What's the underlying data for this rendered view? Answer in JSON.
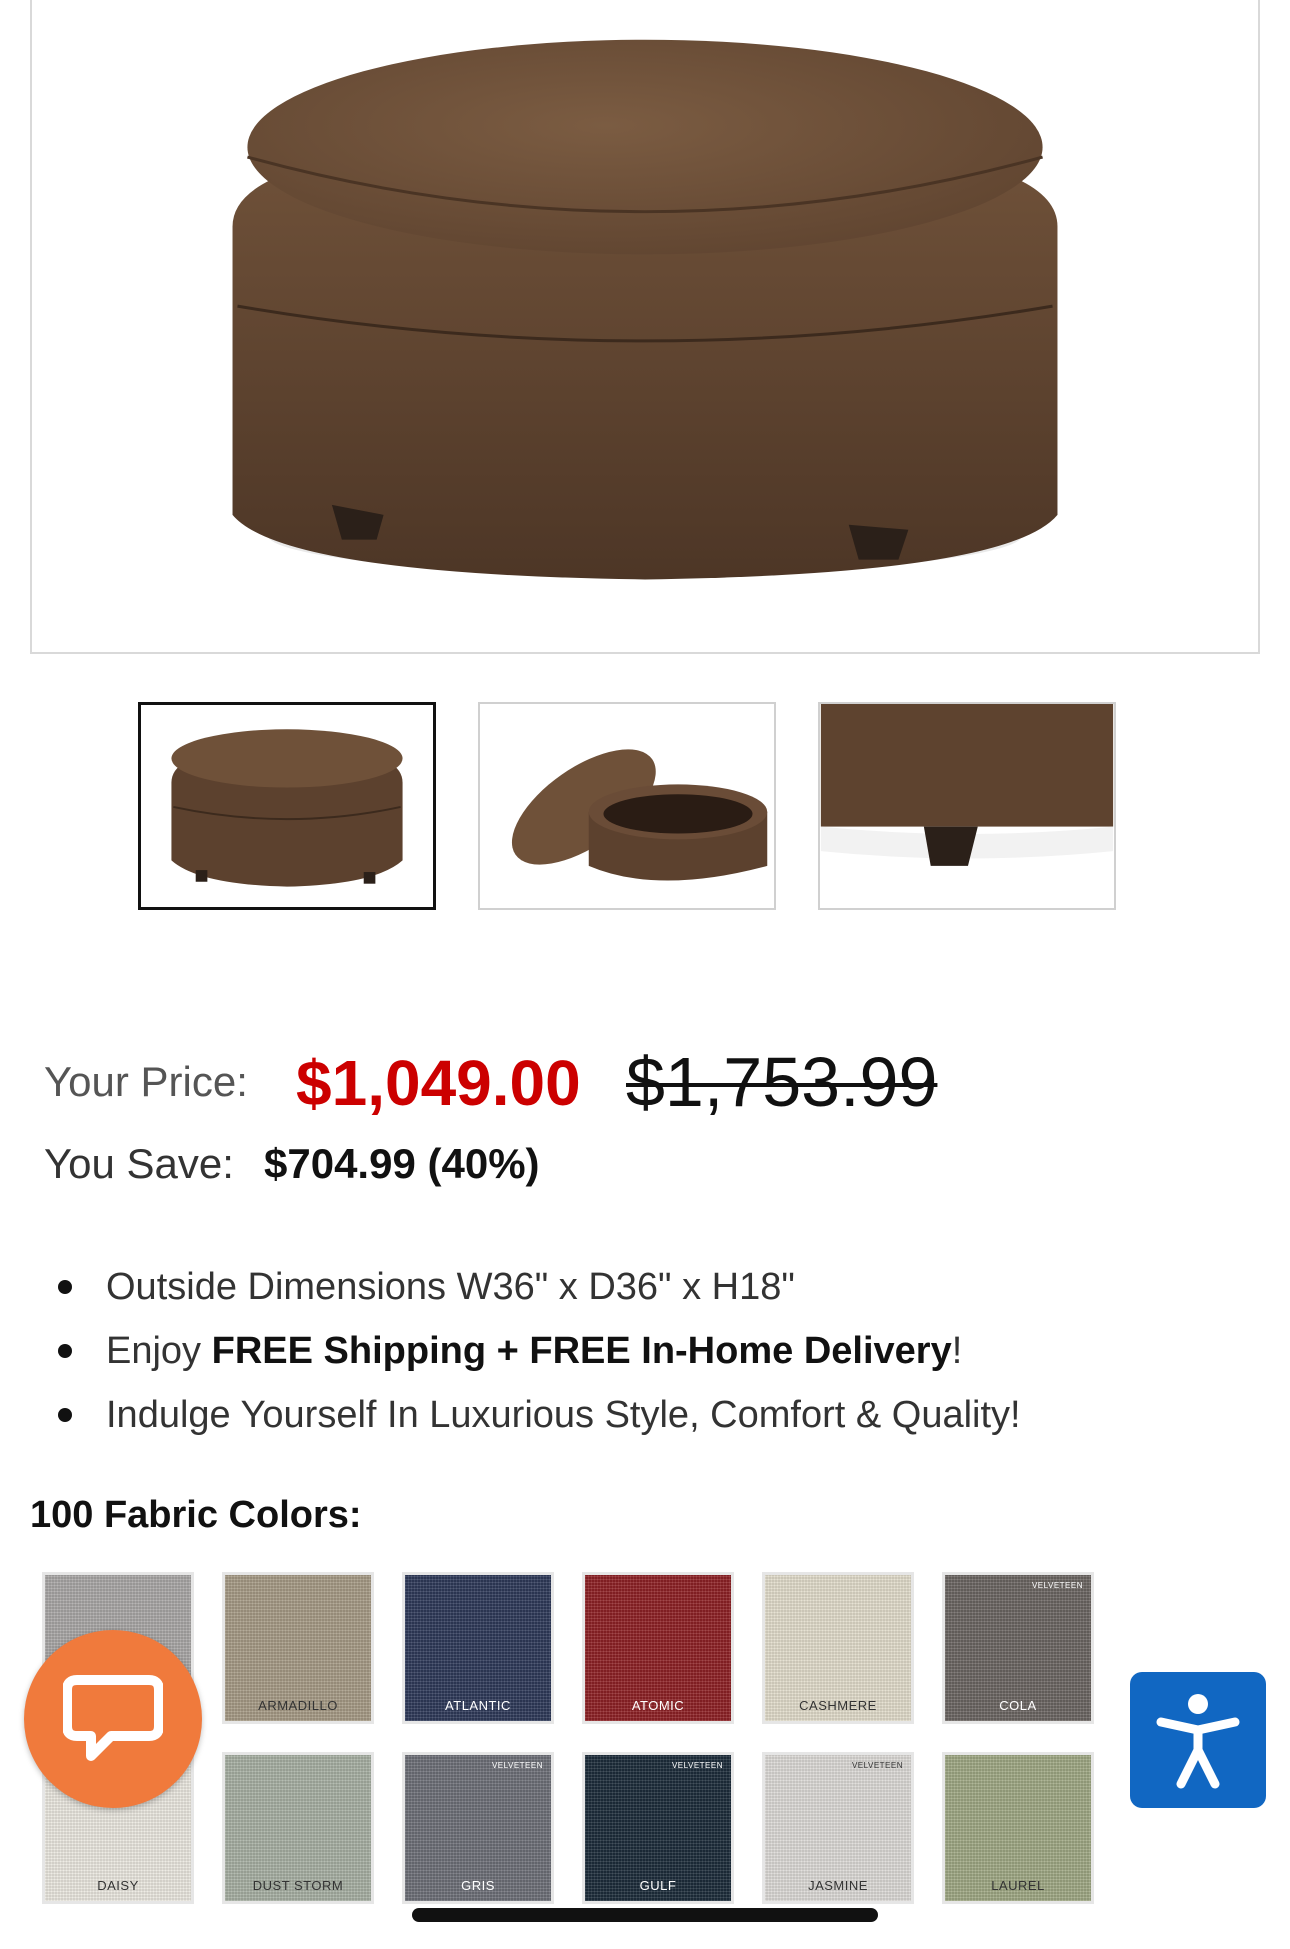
{
  "product": {
    "main_image_alt": "brown round storage ottoman",
    "thumbnails": [
      {
        "alt": "ottoman front view",
        "active": true
      },
      {
        "alt": "ottoman open storage view",
        "active": false
      },
      {
        "alt": "ottoman leg detail",
        "active": false
      }
    ]
  },
  "pricing": {
    "your_price_label": "Your Price:",
    "sale_price": "$1,049.00",
    "original_price": "$1,753.99",
    "you_save_label": "You Save:",
    "savings": "$704.99 (40%)",
    "sale_color": "#cc0000"
  },
  "features": [
    {
      "text": "Outside Dimensions W36\" x D36\" x H18\""
    },
    {
      "prefix": "Enjoy ",
      "bold": "FREE Shipping + FREE In-Home Delivery",
      "suffix": "!"
    },
    {
      "text": "Indulge Yourself In Luxurious Style, Comfort & Quality!"
    }
  ],
  "fabric": {
    "heading": "100 Fabric Colors:",
    "swatches": [
      {
        "name": "",
        "color": "#a9a7a6",
        "tag": "",
        "text_color": "#333"
      },
      {
        "name": "ARMADILLO",
        "color": "#a69b86",
        "tag": "",
        "text_color": "#333"
      },
      {
        "name": "ATLANTIC",
        "color": "#2f3a5a",
        "tag": "",
        "text_color": "#ffffff"
      },
      {
        "name": "ATOMIC",
        "color": "#8e2226",
        "tag": "",
        "text_color": "#ffffff"
      },
      {
        "name": "CASHMERE",
        "color": "#e2dccb",
        "tag": "",
        "text_color": "#333"
      },
      {
        "name": "COLA",
        "color": "#6c6663",
        "tag": "VELVETEEN",
        "text_color": "#ffffff"
      },
      {
        "name": "DAISY",
        "color": "#ebe8e0",
        "tag": "",
        "text_color": "#333"
      },
      {
        "name": "DUST STORM",
        "color": "#a7b0a3",
        "tag": "",
        "text_color": "#333"
      },
      {
        "name": "GRIS",
        "color": "#6e7078",
        "tag": "VELVETEEN",
        "text_color": "#ffffff"
      },
      {
        "name": "GULF",
        "color": "#1d2d3b",
        "tag": "VELVETEEN",
        "text_color": "#ffffff"
      },
      {
        "name": "JASMINE",
        "color": "#dcdad7",
        "tag": "VELVETEEN",
        "text_color": "#333"
      },
      {
        "name": "LAUREL",
        "color": "#9fa884",
        "tag": "",
        "text_color": "#333"
      }
    ]
  },
  "widgets": {
    "chat_icon": "chat-bubble-icon",
    "chat_color": "#f07a3c",
    "accessibility_icon": "accessibility-icon",
    "accessibility_color": "#1167c2"
  }
}
